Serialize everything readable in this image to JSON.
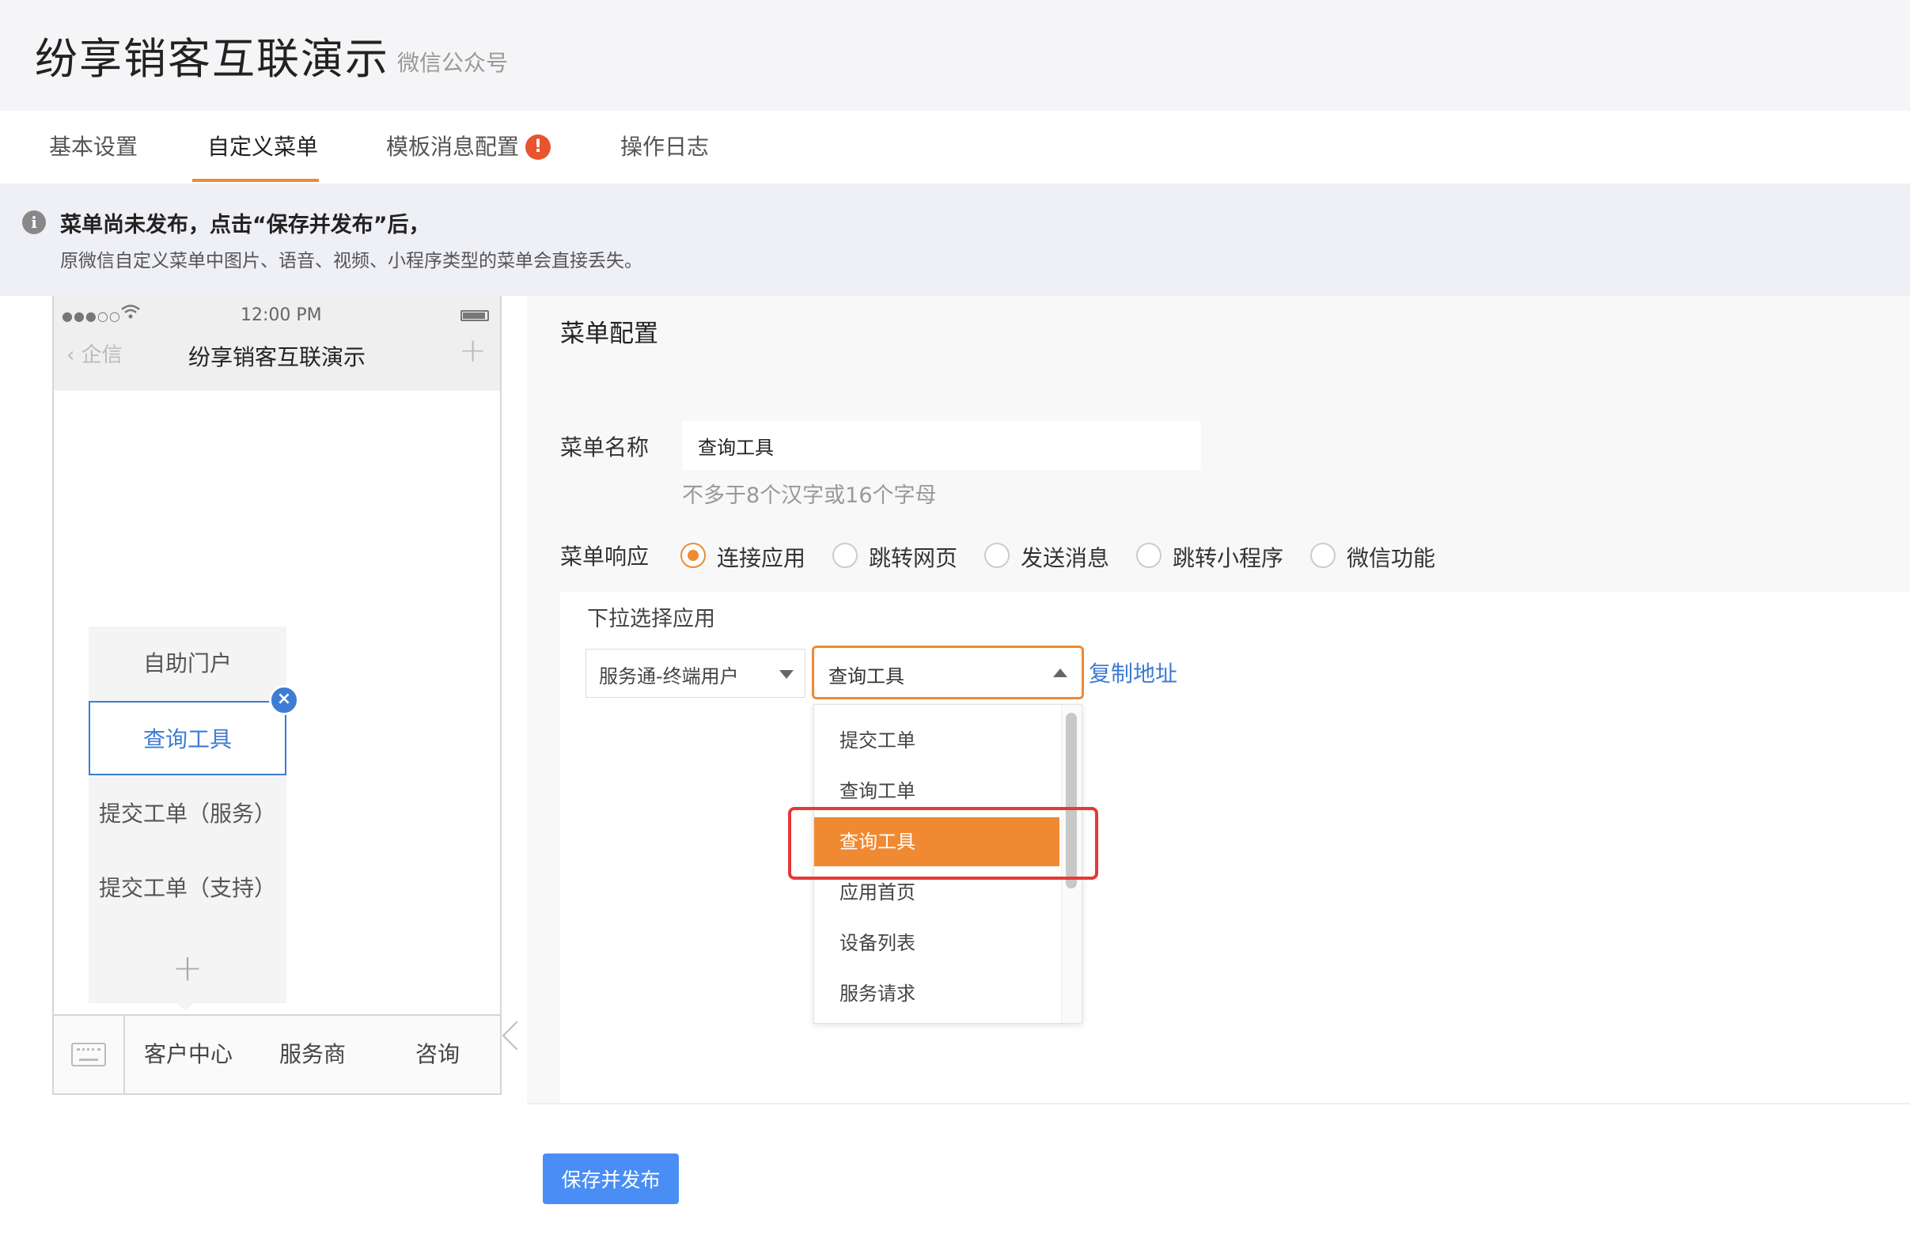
{
  "header": {
    "title": "纷享销客互联演示",
    "subtitle": "微信公众号"
  },
  "tabs": [
    {
      "label": "基本设置"
    },
    {
      "label": "自定义菜单"
    },
    {
      "label": "模板消息配置"
    },
    {
      "label": "操作日志"
    }
  ],
  "tab_badge": "!",
  "notice": {
    "icon": "i",
    "line1": "菜单尚未发布，点击“保存并发布”后，",
    "line2": "原微信自定义菜单中图片、语音、视频、小程序类型的菜单会直接丢失。"
  },
  "phone": {
    "time": "12:00 PM",
    "status_dots": "●●●○○",
    "back_label": "企信",
    "title": "纷享销客互联演示",
    "submenu": [
      "自助门户",
      "查询工具",
      "提交工单（服务）",
      "提交工单（支持）"
    ],
    "menu": [
      "客户中心",
      "服务商",
      "咨询"
    ]
  },
  "config": {
    "title": "菜单配置",
    "name_label": "菜单名称",
    "name_value": "查询工具",
    "name_hint": "不多于8个汉字或16个字母",
    "response_label": "菜单响应",
    "response_options": [
      "连接应用",
      "跳转网页",
      "发送消息",
      "跳转小程序",
      "微信功能"
    ],
    "response_selected": "连接应用",
    "app_select_label": "下拉选择应用",
    "app_select_1": "服务通-终端用户",
    "app_select_2": "查询工具",
    "copy_link": "复制地址",
    "dropdown_options": [
      "提交工单",
      "查询工单",
      "查询工具",
      "应用首页",
      "设备列表",
      "服务请求"
    ],
    "dropdown_selected": "查询工具"
  },
  "save_button": "保存并发布",
  "colors": {
    "accent": "#ef8a33",
    "link": "#3d7bd4",
    "primary_button": "#4a8ef5",
    "highlight_box": "#e53935"
  }
}
